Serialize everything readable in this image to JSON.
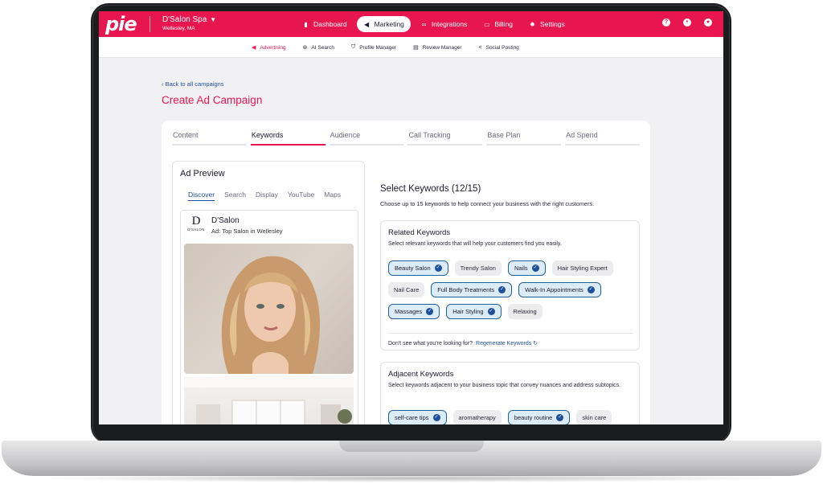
{
  "app": {
    "logo": "pie"
  },
  "business": {
    "name": "D'Salon Spa",
    "location": "Wellesley, MA",
    "caret": "▼"
  },
  "topnav": [
    {
      "label": "Dashboard",
      "icon": "bar-chart-icon"
    },
    {
      "label": "Marketing",
      "icon": "megaphone-icon"
    },
    {
      "label": "Integrations",
      "icon": "link-icon"
    },
    {
      "label": "Billing",
      "icon": "credit-card-icon"
    },
    {
      "label": "Settings",
      "icon": "gear-icon"
    }
  ],
  "subnav": [
    {
      "label": "Advertising",
      "icon": "megaphone-icon"
    },
    {
      "label": "AI Search",
      "icon": "ai-search-icon"
    },
    {
      "label": "Profile Manager",
      "icon": "shield-icon"
    },
    {
      "label": "Review Manager",
      "icon": "chat-icon"
    },
    {
      "label": "Social Posting",
      "icon": "share-icon"
    }
  ],
  "page": {
    "back": "‹ Back to all campaigns",
    "title": "Create Ad Campaign"
  },
  "tabs": [
    "Content",
    "Keywords",
    "Audience",
    "Call Tracking",
    "Base Plan",
    "Ad Spend"
  ],
  "preview": {
    "title": "Ad Preview",
    "tabs": [
      "Discover",
      "Search",
      "Display",
      "YouTube",
      "Maps"
    ],
    "ad": {
      "logo_letter": "D",
      "logo_text": "D'SALON",
      "name": "D'Salon",
      "subtitle": "Ad: Top Salon in Wellesley"
    }
  },
  "keywords": {
    "title": "Select Keywords (12/15)",
    "subtitle": "Choose up to 15 keywords to help connect your business with the right customers.",
    "related": {
      "title": "Related Keywords",
      "subtitle": "Select relevant keywords that will help your customers find you easily.",
      "rows": [
        [
          {
            "label": "Beauty Salon",
            "selected": true
          },
          {
            "label": "Trendy Salon",
            "selected": false
          },
          {
            "label": "Nails",
            "selected": true
          },
          {
            "label": "Hair Styling Expert",
            "selected": false
          }
        ],
        [
          {
            "label": "Nail Care",
            "selected": false
          },
          {
            "label": "Full Body Treatments",
            "selected": true
          },
          {
            "label": "Walk-In Appointments",
            "selected": true
          }
        ],
        [
          {
            "label": "Massages",
            "selected": true
          },
          {
            "label": "Hair Styling",
            "selected": true
          },
          {
            "label": "Relaxing",
            "selected": false
          }
        ]
      ],
      "footer_text": "Don't see what you're looking for?",
      "regenerate": "Regenerate Keywords ↻"
    },
    "adjacent": {
      "title": "Adjacent Keywords",
      "subtitle": "Select keywords adjacent to your business topic that convey nuances and address subtopics.",
      "rows": [
        [
          {
            "label": "self-care tips",
            "selected": true
          },
          {
            "label": "aromatherapy",
            "selected": false
          },
          {
            "label": "beauty routine",
            "selected": true
          },
          {
            "label": "skin care",
            "selected": false
          }
        ]
      ]
    }
  },
  "colors": {
    "brand": "#e8164f",
    "accent": "#1f4f9a"
  }
}
